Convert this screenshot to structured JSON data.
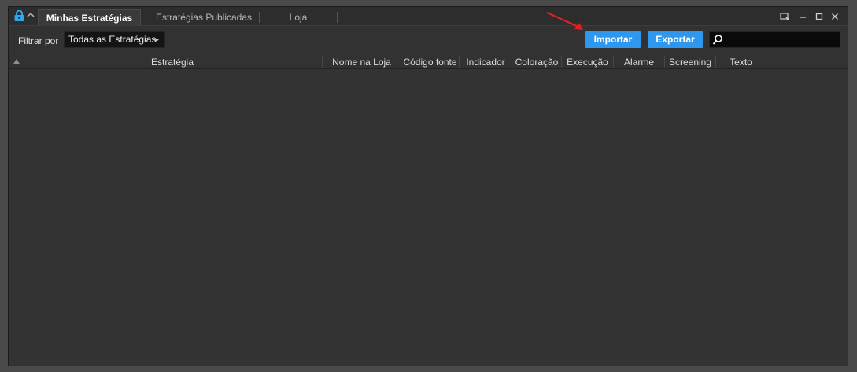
{
  "tabs": [
    {
      "label": "Minhas Estratégias",
      "active": true
    },
    {
      "label": "Estratégias Publicadas",
      "active": false
    },
    {
      "label": "Loja",
      "active": false
    }
  ],
  "filter": {
    "label": "Filtrar por",
    "selected": "Todas as Estratégias"
  },
  "buttons": {
    "import_label": "Importar",
    "export_label": "Exportar"
  },
  "search": {
    "value": ""
  },
  "table": {
    "columns": [
      "Estratégia",
      "Nome na Loja",
      "Código fonte",
      "Indicador",
      "Coloração",
      "Execução",
      "Alarme",
      "Screening",
      "Texto"
    ],
    "rows": []
  },
  "colors": {
    "accent": "#2e97ee",
    "window_bg": "#323232",
    "annotation_arrow": "#e02020"
  },
  "icons": [
    "lock-icon",
    "chevron-up-icon",
    "popout-icon",
    "minimize-icon",
    "maximize-icon",
    "close-icon",
    "search-icon",
    "sort-ascending-icon"
  ]
}
